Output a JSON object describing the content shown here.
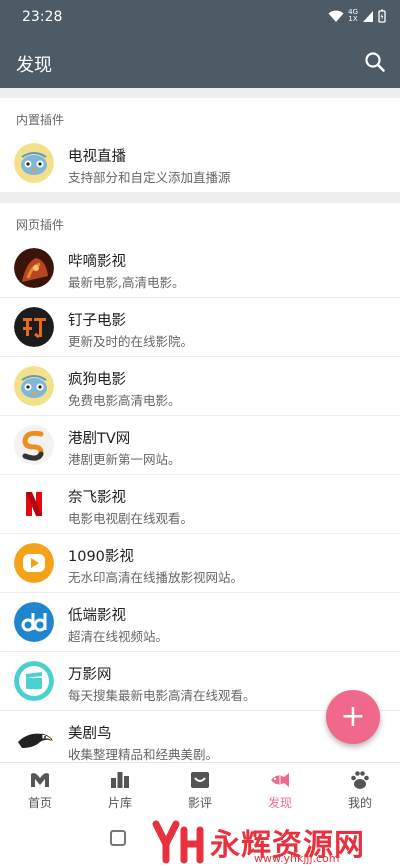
{
  "status_bar": {
    "time": "23:28",
    "network": "4G",
    "network_sub": "1X"
  },
  "app_bar": {
    "title": "发现"
  },
  "sections": [
    {
      "header": "内置插件",
      "items": [
        {
          "name": "电视直播",
          "desc": "支持部分和自定义添加直播源",
          "icon": "bird-icon"
        }
      ]
    },
    {
      "header": "网页插件",
      "items": [
        {
          "name": "哔嘀影视",
          "desc": "最新电影,高清电影。",
          "icon": "warrior-icon"
        },
        {
          "name": "钉子电影",
          "desc": "更新及时的在线影院。",
          "icon": "ding-icon"
        },
        {
          "name": "疯狗电影",
          "desc": "免费电影高清电影。",
          "icon": "bird-icon"
        },
        {
          "name": "港剧TV网",
          "desc": "港剧更新第一网站。",
          "icon": "s-logo-icon"
        },
        {
          "name": "奈飞影视",
          "desc": "电影电视剧在线观看。",
          "icon": "n-logo-icon"
        },
        {
          "name": "1090影视",
          "desc": "无水印高清在线播放影视网站。",
          "icon": "play-icon"
        },
        {
          "name": "低端影视",
          "desc": "超清在线视频站。",
          "icon": "dd-icon"
        },
        {
          "name": "万影网",
          "desc": "每天搜集最新电影高清在线观看。",
          "icon": "clapper-icon"
        },
        {
          "name": "美剧鸟",
          "desc": "收集整理精品和经典美剧。",
          "icon": "eagle-icon"
        }
      ]
    }
  ],
  "fab": {
    "label": "+"
  },
  "bottom_nav": [
    {
      "label": "首页",
      "icon": "home-icon"
    },
    {
      "label": "片库",
      "icon": "library-icon"
    },
    {
      "label": "影评",
      "icon": "review-icon"
    },
    {
      "label": "发现",
      "icon": "discover-icon",
      "active": true
    },
    {
      "label": "我的",
      "icon": "profile-icon"
    }
  ],
  "watermark": {
    "text": "永辉资源网",
    "url": "www.yhkjjj.com"
  },
  "colors": {
    "toolbar": "#4d5b66",
    "accent": "#f0698a"
  }
}
